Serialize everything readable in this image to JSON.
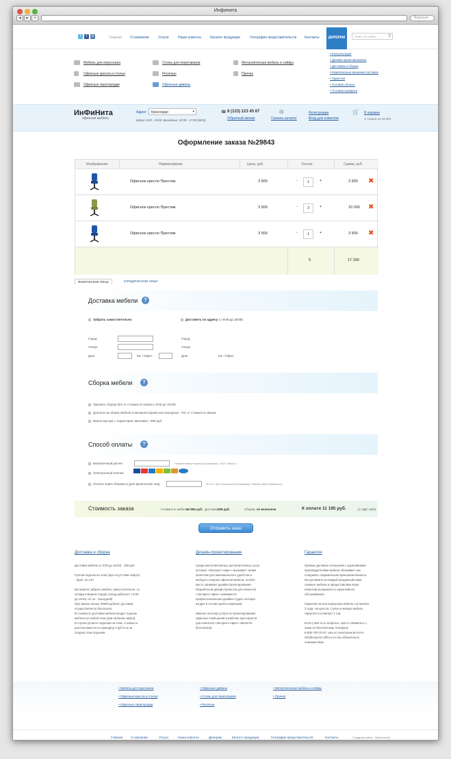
{
  "window": {
    "title": "Инфинита"
  },
  "browser": {
    "search_placeholder": "Ведущие"
  },
  "nav": {
    "items": [
      "Главная",
      "О компании",
      "Услуги",
      "Наши клиенты",
      "Каталог продукции",
      "География представительств",
      "Контакты"
    ],
    "dealers": "ДИЛЕРАМ",
    "search_placeholder": "Поиск по сайту"
  },
  "catalog": {
    "col1": [
      "Мебель для персонала",
      "Офисные кресла и стулья",
      "Офисные перегородки"
    ],
    "col2": [
      "Столы для переговоров",
      "Ресепшн",
      "Офисные диваны"
    ],
    "col3": [
      "Металлическая мебель и сейфы",
      "Прочее"
    ],
    "services": [
      "Консультация",
      "Дизайн-проектирование",
      "Доставка и сборка",
      "Комплексные решения поставок",
      "Гарантия",
      "Условия оплаты",
      "Условия возврата"
    ]
  },
  "header": {
    "logo": "ИнФиНита",
    "logo_sub": "офисная мебель",
    "address_label": "Адрес:",
    "city": "Краснодар",
    "hours": "Будни: 8:00 - 19:00, Выходные: 10:00 - 17:00 (МСК)",
    "phone": "8 (123) 123 45 67",
    "callback": "Обратный звонок",
    "download": "Скачать каталог",
    "register": "Регистрация",
    "login": "Вход для клиентов",
    "cart": "В корзине",
    "cart_sub": "3 товара на 29 800"
  },
  "order": {
    "title": "Оформление заказа №29843",
    "columns": [
      "Изображение",
      "Наименование",
      "Цена, руб.",
      "Кол-во",
      "Сумма, руб."
    ],
    "rows": [
      {
        "name": "Офисное кресло Престиж",
        "price": "3 500",
        "qty": "1",
        "sum": "3 500"
      },
      {
        "name": "Офисное кресло Престиж",
        "price": "3 500",
        "qty": "3",
        "sum": "10 000"
      },
      {
        "name": "Офисное кресло Престиж",
        "price": "3 500",
        "qty": "1",
        "sum": "3 500"
      }
    ],
    "total_qty": "5",
    "total_sum": "17 300",
    "minus": "-",
    "plus": "+"
  },
  "tabs": [
    "ФИЗИЧЕСКОЕ ЛИЦО",
    "ЮРИДИЧЕСКОЕ ЛИЦО"
  ],
  "delivery": {
    "title": "Доставка мебели",
    "pickup": "Забрать самостоятельно",
    "address": "Доставить по адресу",
    "address_hours": "( с 9:00 до 18:00)",
    "city": "Город:",
    "street": "Улица:",
    "house": "Дом:",
    "apt": "Кв. / Офис:"
  },
  "assembly": {
    "title": "Сборка мебели",
    "options": [
      "Заказать сборку (5% от стоимости заказа с 9:00 до 18:00)",
      "Доплата за сборку мебели в вечернее время или выходные - 5% от стоимости заказа.",
      "Вывоз мусора с территории заказчика - 899 руб."
    ]
  },
  "payment": {
    "title": "Способ оплаты",
    "cashless": "Безналичный расчет",
    "cashless_hint": "Наименование юрлица (например, ООО \"Ммос\")",
    "electronic": "Электронный платеж:",
    "sber": "Оплата через сберкассу (для физических лиц)",
    "sber_hint": "Ф.И.О. без сокращений (например, Иванов Иван Иванович)"
  },
  "cost": {
    "title": "Стоимость заказа",
    "furniture": "Стоимость мебели:",
    "furniture_val": "10 896 руб.",
    "delivery": "Доставка:",
    "delivery_val": "299 руб.",
    "assembly": "Сборка:",
    "assembly_val": "не включена",
    "pay_label": "К оплате 11 195 руб.",
    "vat": "(с НДС 18%)"
  },
  "submit": "Отправить заказ",
  "footer_info": {
    "delivery_title": "Доставка и сборка",
    "delivery_text": [
      "Доставка мебели (с 9:00 до 18:00) - 299 руб.",
      "",
      "Ручной подъем на этаж (при отсутствии лифта)",
      "- 3руб. за 1 м³",
      "",
      "Вы можете забрать мебель самостоятельно, со",
      "склада в Вашем городе (склад работает с 9:00",
      "до 18:00, сб, вс - выходной)",
      "При заказе свыше 30000 рублей, доставка",
      "осуществляется бесплатно.",
      "В стоимость доставки мебели входит подъем",
      "мебели на любой этаж (при наличии лифта).",
      "В случае ручного подъема на этаж, стоимость",
      "рассчитывается по принципу 3 руб./1 м за",
      "1подню этаж подъема."
    ],
    "design_title": "Дизайн-проектирование",
    "design_text": [
      "Среди многочисленных дополнительных услуг,",
      "которые «Экспресс-офис» оказывает своим",
      "клиентам для максимального удобства в",
      "выборе и покупке офисной мебели, особое",
      "место занимает дизайн-проектирование.",
      "Разработкой дизайн-проектов для клиентов",
      "«Экспресс-офис» занимается",
      "профессиональная дизайн-студия, которая",
      "входит в состав группы компаний.",
      "",
      "Именно поэтому услуга по проектированию",
      "офисных помещений и рабочих пространств",
      "для клиентов «Экспресс-офис» является",
      "бесплатной."
    ],
    "warranty_title": "Гарантия",
    "warranty_text": [
      "Прямые деловые отношения с крупнейшими",
      "производителями мебели обязывают нас",
      "следовать современным принципам бизнеса.",
      "Мы ручаемся за каждый проданный нами",
      "элемент мебели и предоставляем всем",
      "клиентам возможность гарантийного",
      "обслуживания.",
      "",
      "Гарантия на всю корпусную мебель составляет",
      "3 года. На кресла, стулья и мягкую мебель",
      "гарантия составляет 1 год.",
      "",
      "Если у Вас есть вопросы, просто свяжитесь с",
      "нами по бесплатному телефону",
      "8-800-700-10-57, или по электронной почте",
      "info@express-office.ru и мы обязательно",
      "поможем Вам."
    ]
  },
  "bottom_catalog": {
    "col1": [
      "Мебель для персонала",
      "Офисные кресла и стулья",
      "Офисные перегородки"
    ],
    "col2": [
      "Офисные диваны",
      "Столы для переговоров",
      "Ресепшн"
    ],
    "col3": [
      "Металлическая мебель и сейфы",
      "Прочее"
    ]
  },
  "footer_nav": {
    "items": [
      "Главная",
      "О компании",
      "Услуги",
      "Наши клиенты",
      "Дилерам",
      "Каталог продукции",
      "География представительств",
      "Контакты"
    ],
    "credit": "Создание сайта - Webformula"
  },
  "colors": {
    "accent": "#2d7ec7",
    "link": "#225a9c",
    "delete": "#e04e1e",
    "header_bg": "#e7f2fb",
    "total_bg": "#f5f8e2"
  }
}
